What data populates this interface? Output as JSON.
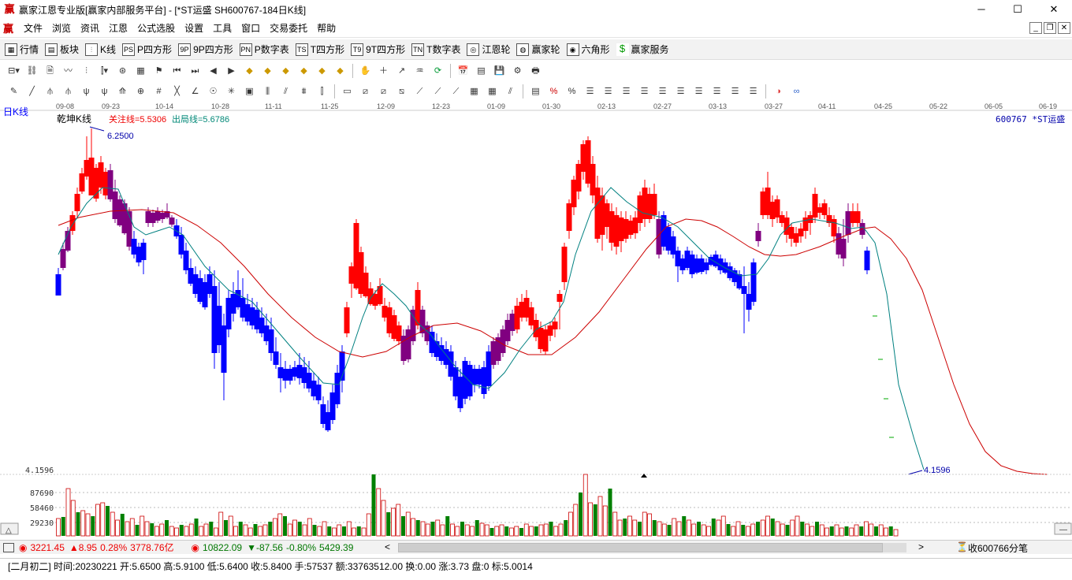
{
  "window": {
    "title": "赢家江恩专业版[赢家内部服务平台] - [*ST运盛  SH600767-184日K线]",
    "app_icon": "赢",
    "minimize": "─",
    "maximize": "☐",
    "close": "✕"
  },
  "menu": {
    "icon": "赢",
    "items": [
      "文件",
      "浏览",
      "资讯",
      "江恩",
      "公式选股",
      "设置",
      "工具",
      "窗口",
      "交易委托",
      "帮助"
    ]
  },
  "toolbar1": [
    {
      "icon": "▦",
      "label": "行情"
    },
    {
      "icon": "▤",
      "label": "板块"
    },
    {
      "icon": "⫶",
      "label": "K线"
    },
    {
      "icon": "PS",
      "label": "P四方形"
    },
    {
      "icon": "9P",
      "label": "9P四方形"
    },
    {
      "icon": "PN",
      "label": "P数字表"
    },
    {
      "icon": "TS",
      "label": "T四方形"
    },
    {
      "icon": "T9",
      "label": "9T四方形"
    },
    {
      "icon": "TN",
      "label": "T数字表"
    },
    {
      "icon": "◎",
      "label": "江恩轮"
    },
    {
      "icon": "◍",
      "label": "赢家轮"
    },
    {
      "icon": "◉",
      "label": "六角形"
    },
    {
      "icon": "$",
      "label": "赢家服务"
    }
  ],
  "chart": {
    "period_label": "日K线",
    "indicator_name": "乾坤K线",
    "focus_line": "关注线=5.5306",
    "exit_line": "出局线=5.6786",
    "code_label": "600767 *ST运盛",
    "high_label": "6.2500",
    "low_label": "4.1596",
    "axis_label": "4.1596",
    "dates": [
      "09-08",
      "09-23",
      "10-14",
      "10-28",
      "11-11",
      "11-25",
      "12-09",
      "12-23",
      "01-09",
      "01-30",
      "02-13",
      "02-27",
      "03-13",
      "03-27",
      "04-11",
      "04-25",
      "05-22",
      "06-05",
      "06-19"
    ],
    "vol_ticks": [
      "87690",
      "58460",
      "29230"
    ],
    "colors": {
      "up": "#ff0000",
      "down": "#0000ff",
      "mix": "#800080",
      "fast_line": "#008080",
      "slow_line": "#cc0000",
      "vol_up": "#cc0000",
      "vol_down": "#008000"
    }
  },
  "status": {
    "sh_index": "3221.45",
    "sh_change": "▲8.95",
    "sh_pct": "0.28%",
    "sh_amount": "3778.76亿",
    "sz_index": "10822.09",
    "sz_change": "▼-87.56",
    "sz_pct": "-0.80%",
    "sz_amount": "5429.39",
    "right_label": "收600766分笔"
  },
  "info_bar": "[二月初二] 时间:20230221 开:5.6500 高:5.9100 低:5.6400 收:5.8400 手:57537 额:33763512.00 换:0.00 涨:3.73 盘:0 标:5.0014"
}
